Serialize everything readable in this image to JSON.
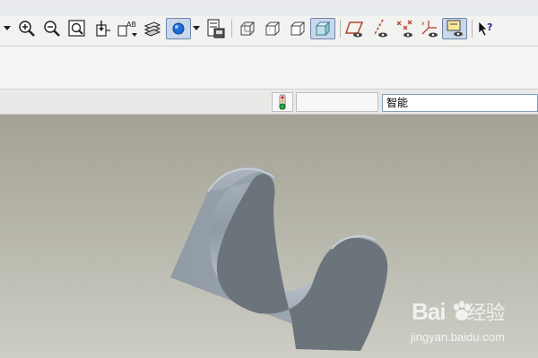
{
  "toolbar": {
    "buttons": [
      {
        "name": "dropdown-arrow-icon"
      },
      {
        "name": "zoom-in-icon"
      },
      {
        "name": "zoom-out-icon"
      },
      {
        "name": "zoom-fit-icon"
      },
      {
        "name": "reorient-icon"
      },
      {
        "name": "named-view-icon",
        "label": "AB"
      },
      {
        "name": "layers-icon"
      },
      {
        "name": "spin-center-icon",
        "active": true
      },
      {
        "name": "dropdown-arrow-icon"
      },
      {
        "name": "save-view-icon"
      },
      {
        "name": "wireframe-icon"
      },
      {
        "name": "hidden-line-icon"
      },
      {
        "name": "no-hidden-icon"
      },
      {
        "name": "shading-icon",
        "active": true
      },
      {
        "name": "datum-plane-icon"
      },
      {
        "name": "datum-axis-icon"
      },
      {
        "name": "datum-point-icon"
      },
      {
        "name": "coordinate-system-icon"
      },
      {
        "name": "annotation-display-icon",
        "active": true
      },
      {
        "name": "context-help-icon"
      }
    ]
  },
  "status": {
    "filter_value": "智能",
    "regen_status_icon": "traffic-light-icon"
  },
  "watermark": {
    "logo_text": "Bai",
    "logo_text2": "经验",
    "url": "jingyan.baidu.com"
  },
  "colors": {
    "viewport_top": "#a4a295",
    "viewport_bottom": "#cdcdc6",
    "part_shade": "#6b737b",
    "part_light": "#b7c0ca"
  }
}
